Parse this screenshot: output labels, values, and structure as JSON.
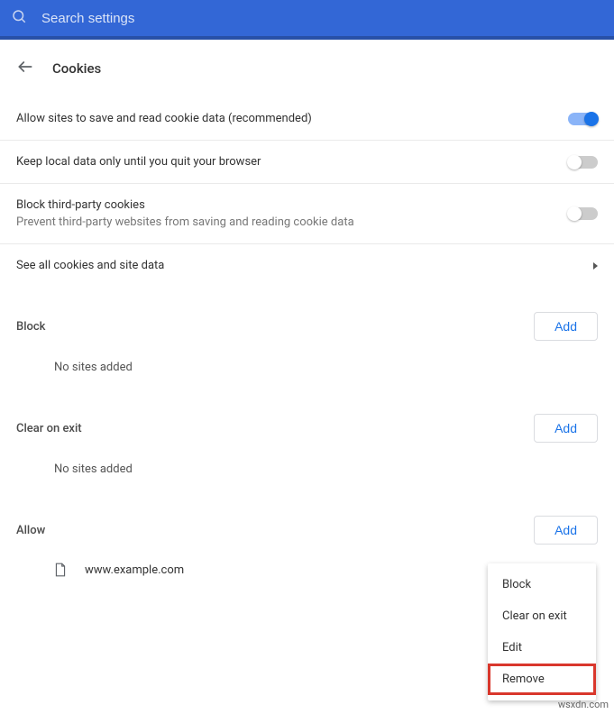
{
  "search": {
    "placeholder": "Search settings"
  },
  "header": {
    "title": "Cookies"
  },
  "toggleRows": {
    "allowSites": {
      "title": "Allow sites to save and read cookie data (recommended)",
      "on": true
    },
    "keepLocal": {
      "title": "Keep local data only until you quit your browser",
      "on": false
    },
    "blockThirdParty": {
      "title": "Block third-party cookies",
      "sub": "Prevent third-party websites from saving and reading cookie data",
      "on": false
    }
  },
  "seeAll": {
    "label": "See all cookies and site data"
  },
  "sections": {
    "block": {
      "title": "Block",
      "addLabel": "Add",
      "emptyText": "No sites added"
    },
    "clearOnExit": {
      "title": "Clear on exit",
      "addLabel": "Add",
      "emptyText": "No sites added"
    },
    "allow": {
      "title": "Allow",
      "addLabel": "Add",
      "site": "www.example.com"
    }
  },
  "contextMenu": {
    "block": "Block",
    "clearOnExit": "Clear on exit",
    "edit": "Edit",
    "remove": "Remove"
  },
  "watermark": "wsxdn.com"
}
